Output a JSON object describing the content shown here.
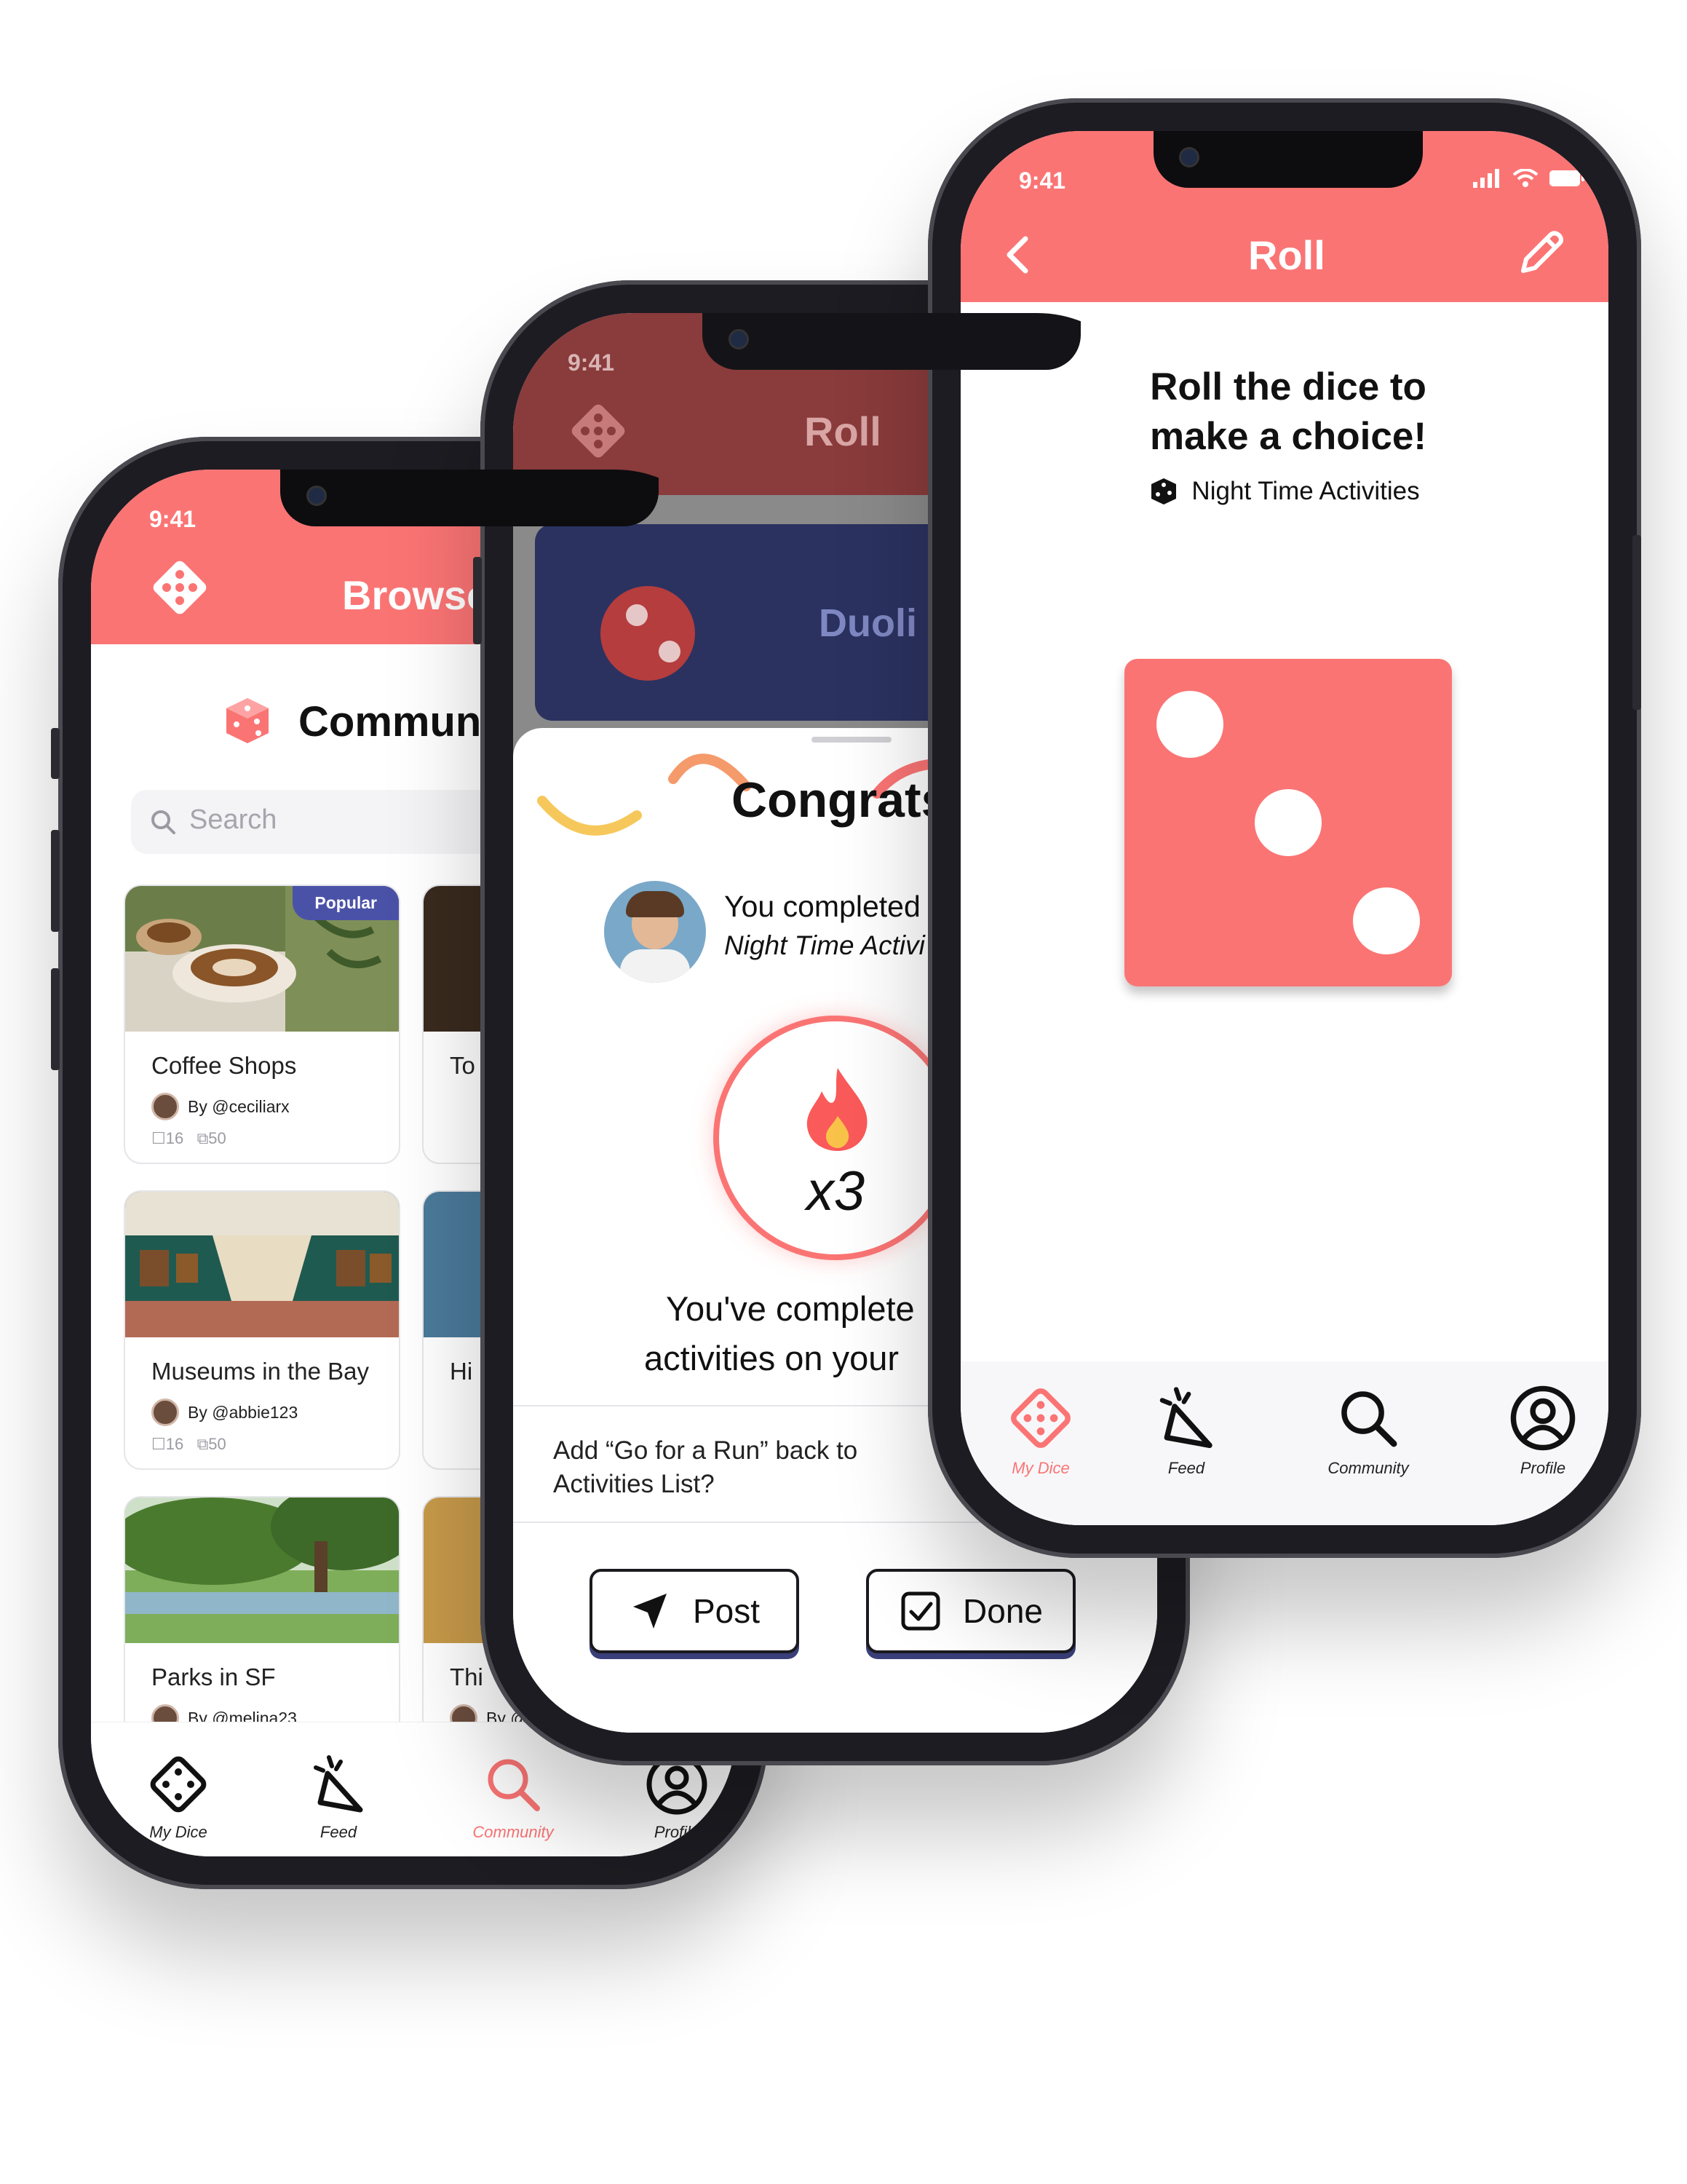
{
  "browse": {
    "time": "9:41",
    "title": "Browse",
    "section_title": "Community",
    "search_placeholder": "Search",
    "popular_badge": "Popular",
    "cards": [
      {
        "title": "Coffee Shops",
        "author": "By @ceciliarx",
        "saves": "16",
        "rolls": "50"
      },
      {
        "title": "Museums in the Bay",
        "author": "By @abbie123",
        "saves": "16",
        "rolls": "50"
      },
      {
        "title": "Parks in SF",
        "author": "By @melina23"
      }
    ],
    "partial_cards": [
      {
        "title": "To"
      },
      {
        "title": "Hi"
      },
      {
        "title": "Thi",
        "author": "By @"
      }
    ],
    "tabs": [
      {
        "label": "My Dice",
        "icon": "dice-icon"
      },
      {
        "label": "Feed",
        "icon": "party-popper-icon"
      },
      {
        "label": "Community",
        "icon": "search-icon"
      },
      {
        "label": "Profile",
        "icon": "profile-icon"
      }
    ]
  },
  "congrats": {
    "time": "9:41",
    "title": "Roll",
    "banner_text": "Duoli",
    "heading": "Congrats",
    "completed_line1": "You completed",
    "completed_line2": "Night Time Activi",
    "streak": "x3",
    "message_line1": "You've complete",
    "message_line2": "activities on your",
    "prompt": "Add “Go for a Run” back to Activities List?",
    "post_label": "Post",
    "done_label": "Done"
  },
  "roll": {
    "time": "9:41",
    "title": "Roll",
    "heading": "Roll the dice to make a choice!",
    "dice_name": "Night Time Activities",
    "tabs": [
      {
        "label": "My Dice",
        "icon": "dice-icon"
      },
      {
        "label": "Feed",
        "icon": "party-popper-icon"
      },
      {
        "label": "Community",
        "icon": "search-icon"
      },
      {
        "label": "Profile",
        "icon": "profile-icon"
      }
    ]
  },
  "colors": {
    "accent": "#fb7474",
    "navy": "#2b3260",
    "badge": "#4a52a8"
  }
}
